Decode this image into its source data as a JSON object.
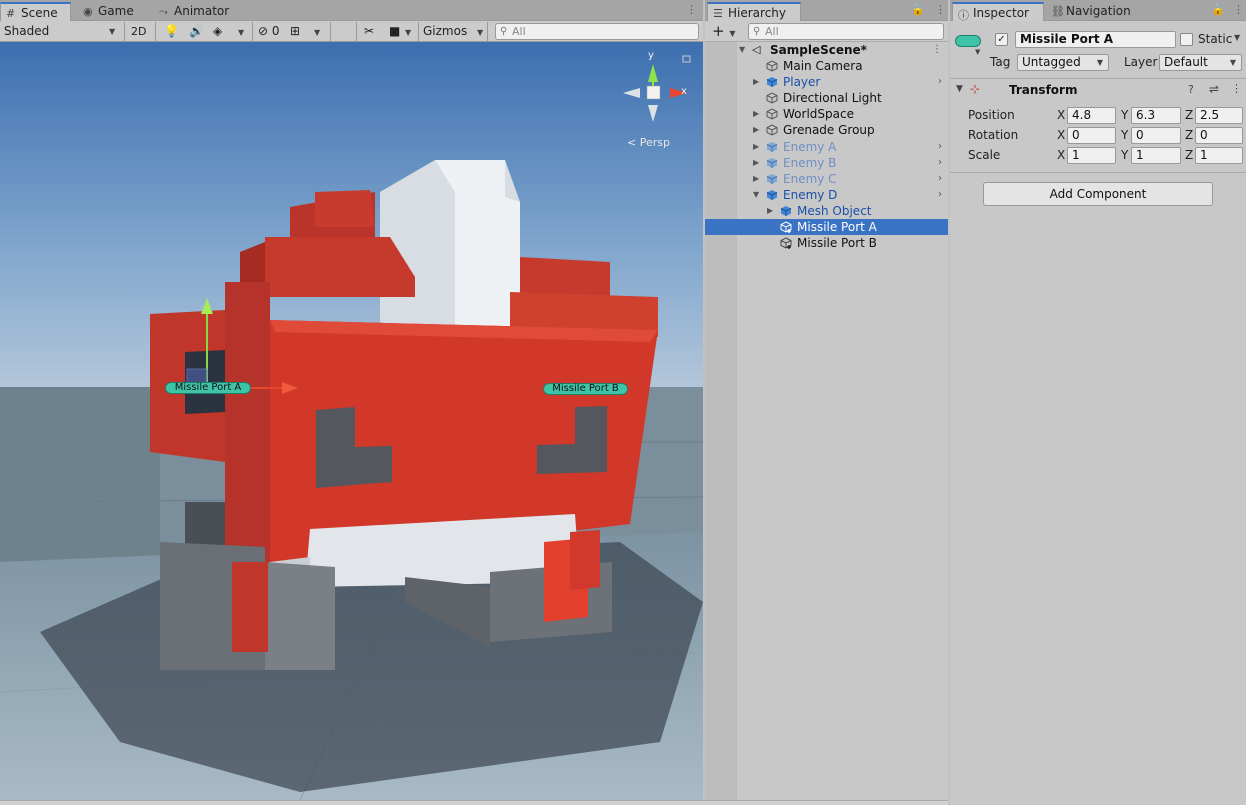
{
  "colors": {
    "accent": "#3a72c4",
    "selection": "#3a72c4",
    "gizmo_label": "#3fc4a8",
    "enemy_red": "#d1382a",
    "sky": "#4a7cb6"
  },
  "scene_panel": {
    "tabs": [
      {
        "label": "Scene",
        "icon": "grid-icon"
      },
      {
        "label": "Game",
        "icon": "gamepad-icon"
      },
      {
        "label": "Animator",
        "icon": "animator-icon"
      }
    ],
    "toolbar": {
      "shading_mode": "Shaded",
      "mode_2d": "2D",
      "hidden_count": "0",
      "gizmos_label": "Gizmos",
      "search_placeholder": "All"
    },
    "viewport": {
      "projection_label": "< Persp",
      "gizmo_axes": {
        "y": "y",
        "x": "x"
      },
      "object_labels": [
        "Missile Port A",
        "Missile Port B"
      ]
    }
  },
  "hierarchy": {
    "tab_label": "Hierarchy",
    "search_placeholder": "All",
    "add_label": "+",
    "items": [
      {
        "label": "SampleScene*",
        "depth": 0,
        "expanded": true,
        "style": "scene"
      },
      {
        "label": "Main Camera",
        "depth": 1,
        "style": "normal"
      },
      {
        "label": "Player",
        "depth": 1,
        "style": "prefab",
        "collapsed": true,
        "has_more": true
      },
      {
        "label": "Directional Light",
        "depth": 1,
        "style": "normal"
      },
      {
        "label": "WorldSpace",
        "depth": 1,
        "style": "normal",
        "collapsed": true
      },
      {
        "label": "Grenade Group",
        "depth": 1,
        "style": "normal",
        "collapsed": true
      },
      {
        "label": "Enemy A",
        "depth": 1,
        "style": "prefab-faded",
        "collapsed": true,
        "has_more": true
      },
      {
        "label": "Enemy B",
        "depth": 1,
        "style": "prefab-faded",
        "collapsed": true,
        "has_more": true
      },
      {
        "label": "Enemy C",
        "depth": 1,
        "style": "prefab-faded",
        "collapsed": true,
        "has_more": true
      },
      {
        "label": "Enemy D",
        "depth": 1,
        "style": "prefab",
        "expanded": true,
        "has_more": true
      },
      {
        "label": "Mesh Object",
        "depth": 2,
        "style": "prefab",
        "collapsed": true
      },
      {
        "label": "Missile Port A",
        "depth": 2,
        "style": "added",
        "selected": true
      },
      {
        "label": "Missile Port B",
        "depth": 2,
        "style": "added"
      }
    ]
  },
  "inspector": {
    "tabs": [
      {
        "label": "Inspector",
        "icon": "info-icon"
      },
      {
        "label": "Navigation",
        "icon": "navigation-icon"
      }
    ],
    "object_name": "Missile Port A",
    "active": true,
    "static_label": "Static",
    "static_checked": false,
    "tag_label": "Tag",
    "tag_value": "Untagged",
    "layer_label": "Layer",
    "layer_value": "Default",
    "transform": {
      "title": "Transform",
      "rows": [
        {
          "label": "Position",
          "x": "4.8",
          "y": "6.3",
          "z": "2.5"
        },
        {
          "label": "Rotation",
          "x": "0",
          "y": "0",
          "z": "0"
        },
        {
          "label": "Scale",
          "x": "1",
          "y": "1",
          "z": "1"
        }
      ],
      "axis_labels": {
        "x": "X",
        "y": "Y",
        "z": "Z"
      }
    },
    "add_component_label": "Add Component"
  }
}
